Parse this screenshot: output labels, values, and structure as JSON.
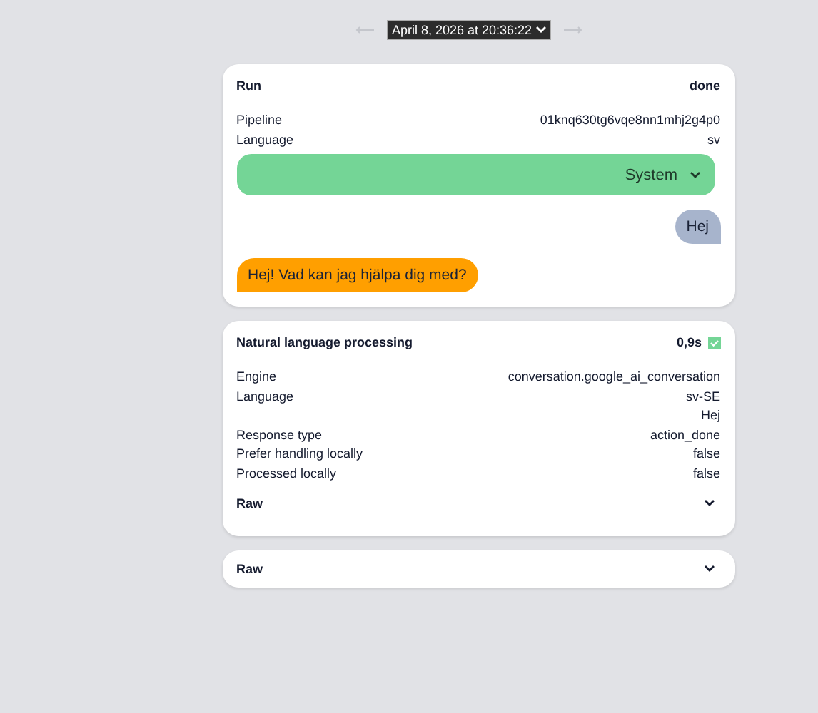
{
  "run_picker": {
    "value": "April 8, 2026 at 20:36:22",
    "prev_disabled": true,
    "next_disabled": true
  },
  "run_card": {
    "title": "Run",
    "status": "done",
    "rows": [
      {
        "label": "Pipeline",
        "value": "01knq630tg6vqe8nn1mhj2g4p0"
      },
      {
        "label": "Language",
        "value": "sv"
      }
    ],
    "system_bar": {
      "label": "System",
      "expanded": false
    },
    "messages": [
      {
        "kind": "user",
        "text": "Hej"
      },
      {
        "kind": "assistant",
        "text": "Hej! Vad kan jag hjälpa dig med?"
      }
    ]
  },
  "nlp_card": {
    "title": "Natural language processing",
    "time": "0,9s",
    "done": true,
    "rows": [
      {
        "label": "Engine",
        "value": "conversation.google_ai_conversation"
      },
      {
        "label": "Language",
        "value": "sv-SE"
      },
      {
        "label": "",
        "value": "Hej"
      },
      {
        "label": "Response type",
        "value": "action_done"
      },
      {
        "label": "Prefer handling locally",
        "value": "false"
      },
      {
        "label": "Processed locally",
        "value": "false"
      }
    ],
    "raw": {
      "label": "Raw",
      "expanded": false
    }
  },
  "raw_card": {
    "label": "Raw",
    "expanded": false
  }
}
